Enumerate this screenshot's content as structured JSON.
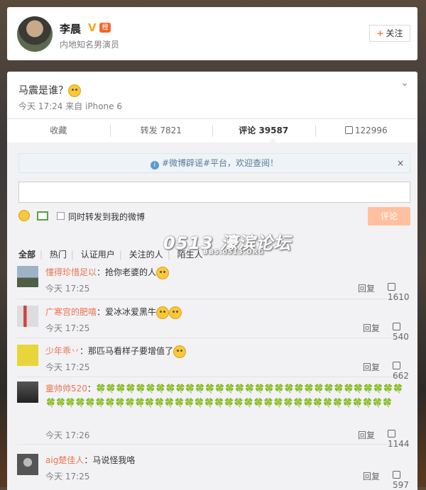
{
  "profile": {
    "name": "李晨",
    "verified_badge": "V",
    "vip_badge": "橙",
    "description": "内地知名男演员",
    "follow_label": "关注"
  },
  "post": {
    "text": "马震是谁？",
    "meta": "今天 17:24 来自 iPhone 6",
    "actions": {
      "favorite": "收藏",
      "repost": "转发 7821",
      "comment": "评论 39587",
      "like": "122996"
    }
  },
  "comment_box": {
    "notice": "#微博辟谣#平台，欢迎查阅！",
    "close": "×",
    "forward_label": "同时转发到我的微博",
    "submit_label": "评论"
  },
  "filters": [
    "全部",
    "热门",
    "认证用户",
    "关注的人",
    "陌生人"
  ],
  "watermark": {
    "main": "0513 濠滨论坛",
    "sub": "BBS.0513.ORG"
  },
  "comments": [
    {
      "user": "懂得珍惜足以",
      "text": "：抢你老婆的人",
      "time": "今天 17:25",
      "reply": "回复",
      "likes": "1610",
      "avatar_color": "#7b8fa6"
    },
    {
      "user": "广寒宫的肥嘻",
      "text": "：爱冰冰爱黑牛",
      "time": "今天 17:25",
      "reply": "回复",
      "likes": "540",
      "avatar_color": "#b9b2aa"
    },
    {
      "user": "少年乖丷",
      "text": "：那匹马看样子要增值了",
      "time": "今天 17:25",
      "reply": "回复",
      "likes": "662",
      "avatar_color": "#e3d23b"
    },
    {
      "user": "童帅帅520",
      "text": "：",
      "time": "今天 17:26",
      "reply": "回复",
      "likes": "1144",
      "avatar_color": "#2e2e2e",
      "clovers": "🍀🍀🍀🍀🍀🍀🍀🍀🍀🍀🍀🍀🍀🍀🍀🍀🍀🍀🍀🍀🍀🍀🍀🍀🍀🍀🍀🍀🍀🍀🍀🍀🍀🍀🍀🍀🍀🍀🍀🍀🍀🍀🍀🍀🍀🍀🍀🍀🍀🍀🍀🍀🍀🍀🍀🍀🍀🍀🍀🍀🍀🍀🍀🍀🍀🍀"
    },
    {
      "user": "aig楚佳人",
      "text": "：马说怪我咯",
      "time": "今天 17:25",
      "reply": "回复",
      "likes": "597",
      "avatar_color": "#6a6a6a"
    }
  ]
}
